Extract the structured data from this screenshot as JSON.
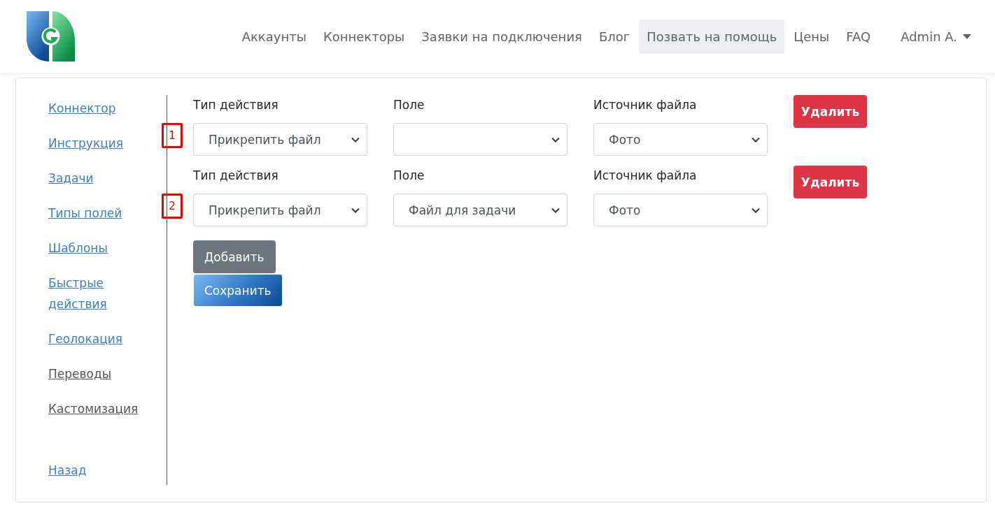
{
  "nav": {
    "items": [
      {
        "label": "Аккаунты",
        "selected": false
      },
      {
        "label": "Коннекторы",
        "selected": false
      },
      {
        "label": "Заявки на подключения",
        "selected": false
      },
      {
        "label": "Блог",
        "selected": false
      },
      {
        "label": "Позвать на помощь",
        "selected": true
      },
      {
        "label": "Цены",
        "selected": false
      },
      {
        "label": "FAQ",
        "selected": false
      }
    ],
    "user": "Admin A."
  },
  "sidebar": {
    "items": [
      {
        "label": "Коннектор",
        "visited": false
      },
      {
        "label": "Инструкция",
        "visited": false
      },
      {
        "label": "Задачи",
        "visited": false
      },
      {
        "label": "Типы полей",
        "visited": false
      },
      {
        "label": "Шаблоны",
        "visited": false
      },
      {
        "label": "Быстрые действия",
        "visited": false
      },
      {
        "label": "Геолокация",
        "visited": false
      },
      {
        "label": "Переводы",
        "visited": true
      },
      {
        "label": "Кастомизация",
        "visited": true
      }
    ],
    "back": {
      "label": "Назад",
      "visited": false
    }
  },
  "rows": [
    {
      "marker": "1",
      "fields": [
        {
          "label": "Тип действия",
          "value": "Прикрепить файл"
        },
        {
          "label": "Поле"
        },
        {
          "label": "Источник файла",
          "value": "Фото"
        }
      ],
      "delete": "Удалить"
    },
    {
      "marker": "2",
      "fields": [
        {
          "label": "Тип действия",
          "value": "Прикрепить файл"
        },
        {
          "label": "Поле",
          "value": "Файл для задачи"
        },
        {
          "label": "Источник файла",
          "value": "Фото"
        }
      ],
      "delete": "Удалить"
    }
  ],
  "add_button": "Добавить",
  "save_button": "Сохранить"
}
